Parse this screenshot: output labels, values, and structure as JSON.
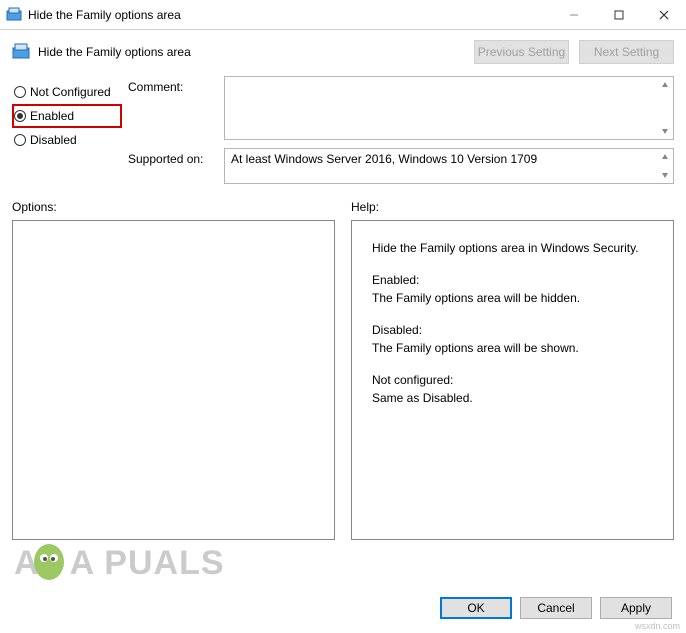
{
  "window": {
    "title": "Hide the Family options area",
    "subtitle": "Hide the Family options area"
  },
  "nav": {
    "previous": "Previous Setting",
    "next": "Next Setting"
  },
  "state": {
    "not_configured": "Not Configured",
    "enabled": "Enabled",
    "disabled": "Disabled",
    "selected": "enabled"
  },
  "labels": {
    "comment": "Comment:",
    "supported_on": "Supported on:",
    "options": "Options:",
    "help": "Help:"
  },
  "comment": "",
  "supported_on": "At least Windows Server 2016, Windows 10 Version 1709",
  "help": {
    "line1": "Hide the Family options area in Windows Security.",
    "enabled_h": "Enabled:",
    "enabled_t": "The Family options area will be hidden.",
    "disabled_h": "Disabled:",
    "disabled_t": "The Family options area will be shown.",
    "nc_h": "Not configured:",
    "nc_t": "Same as Disabled."
  },
  "buttons": {
    "ok": "OK",
    "cancel": "Cancel",
    "apply": "Apply"
  },
  "watermark": {
    "brand": "A   PUALS",
    "tail": "wsxdn.com"
  }
}
